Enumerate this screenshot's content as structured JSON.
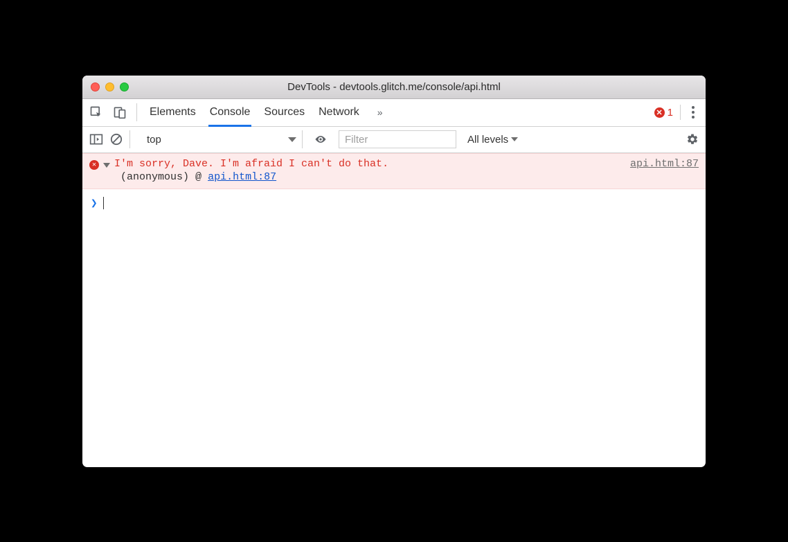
{
  "window": {
    "title": "DevTools - devtools.glitch.me/console/api.html"
  },
  "tabs": {
    "elements": "Elements",
    "console": "Console",
    "sources": "Sources",
    "network": "Network",
    "more": "»"
  },
  "error_count": "1",
  "filterbar": {
    "context": "top",
    "filter_placeholder": "Filter",
    "levels": "All levels"
  },
  "console": {
    "error": {
      "message": "I'm sorry, Dave. I'm afraid I can't do that.",
      "source": "api.html:87",
      "stack_func": "(anonymous)",
      "stack_at": "@",
      "stack_link": "api.html:87"
    },
    "prompt": "❯"
  }
}
